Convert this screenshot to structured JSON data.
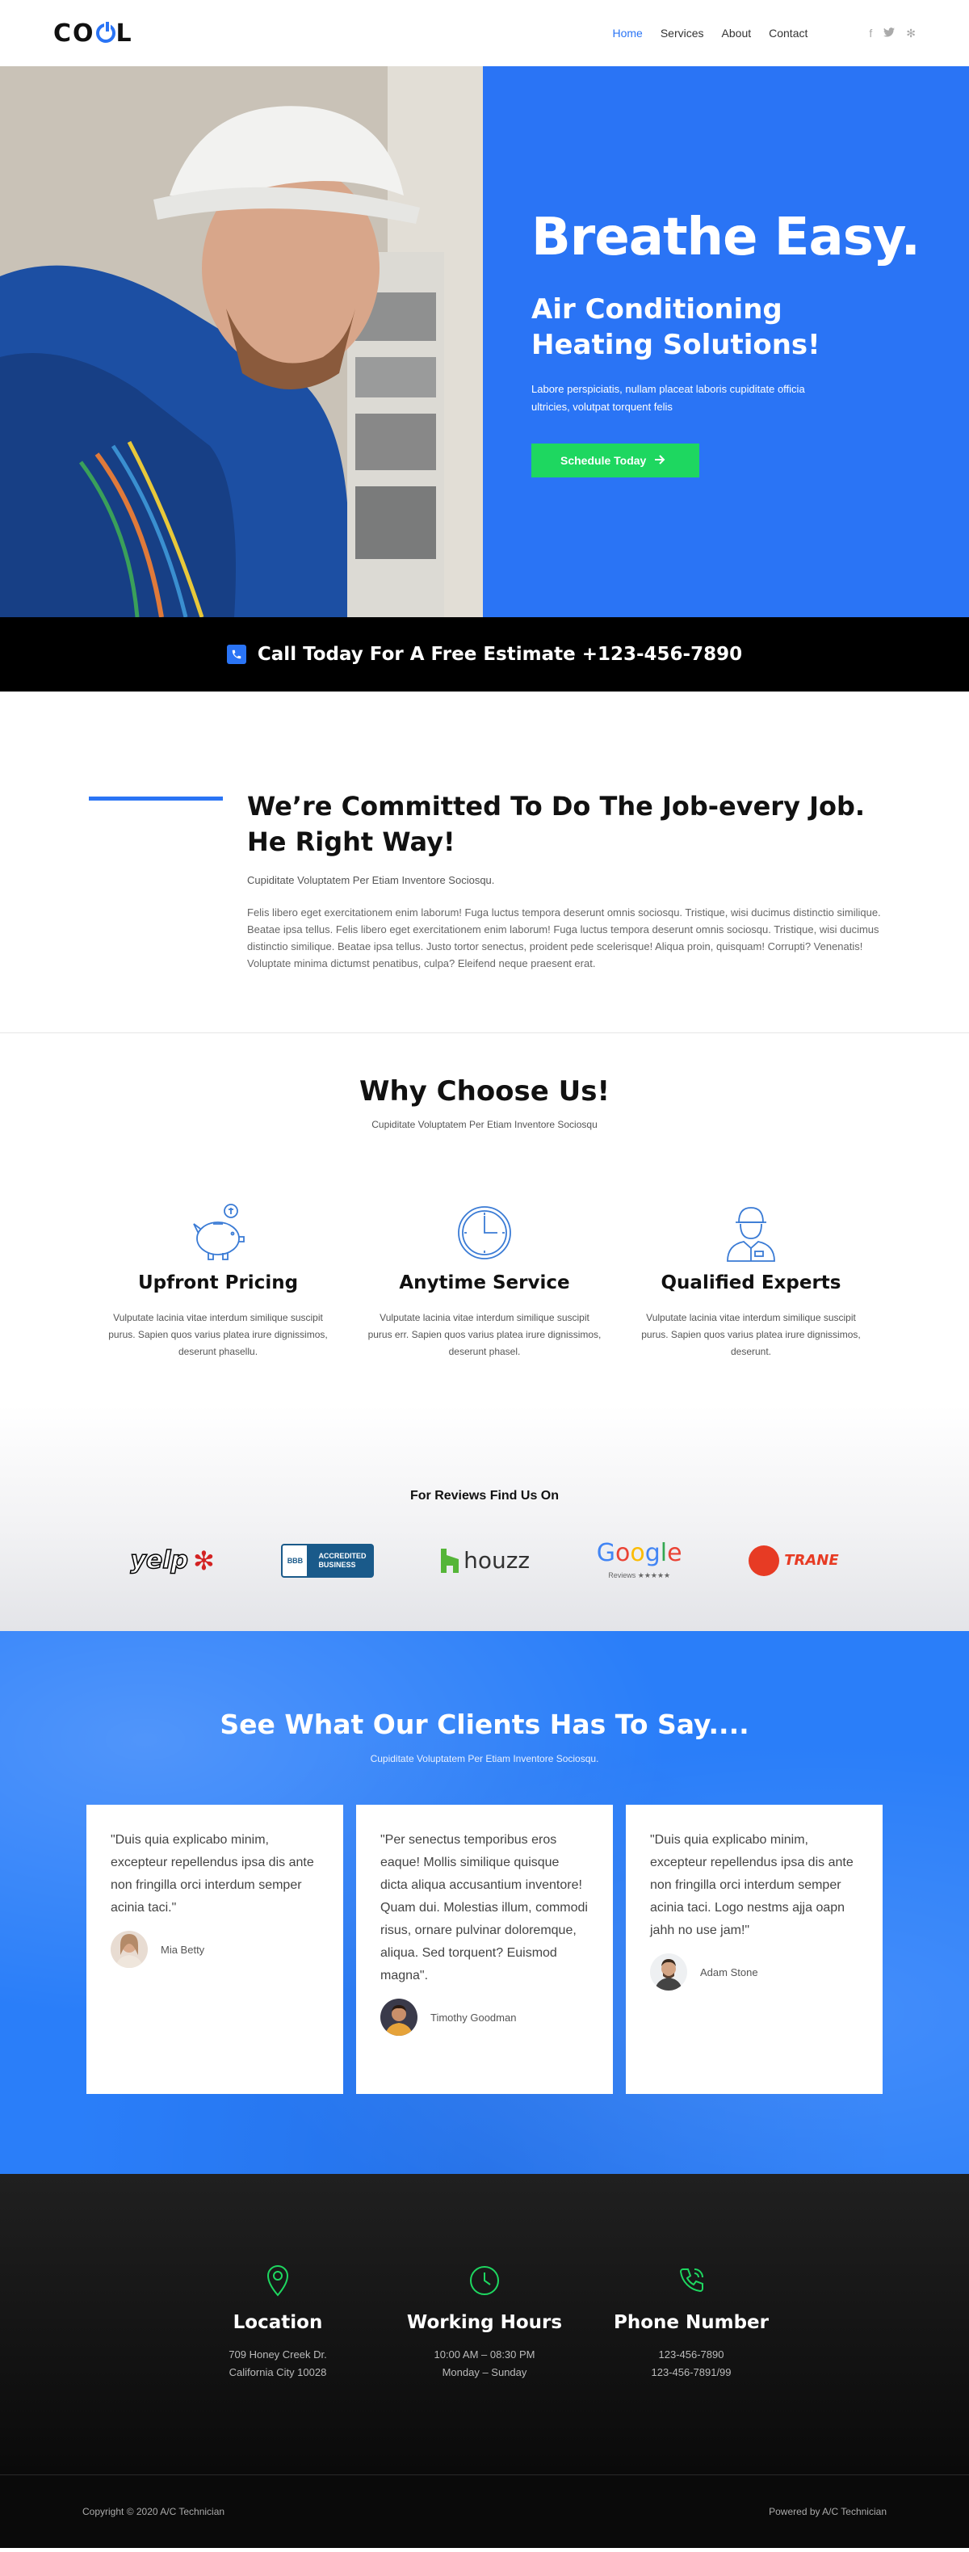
{
  "header": {
    "logo_pre": "C",
    "logo_post": "L",
    "nav": [
      {
        "label": "Home",
        "active": true
      },
      {
        "label": "Services",
        "active": false
      },
      {
        "label": "About",
        "active": false
      },
      {
        "label": "Contact",
        "active": false
      }
    ],
    "social": [
      {
        "icon": "facebook-icon",
        "glyph": "f"
      },
      {
        "icon": "twitter-icon",
        "glyph": "t"
      },
      {
        "icon": "yelp-icon",
        "glyph": "✻"
      }
    ]
  },
  "hero": {
    "title": "Breathe Easy.",
    "subtitle": "Air Conditioning Heating Solutions!",
    "text": "Labore perspiciatis, nullam placeat laboris cupiditate officia ultricies, volutpat torquent felis",
    "button_label": "Schedule Today",
    "button_icon": "arrow-right-icon"
  },
  "callbar": {
    "icon": "phone-icon",
    "text": "Call Today For A Free Estimate +123-456-7890"
  },
  "commit": {
    "title": "We’re Committed To Do The Job-every Job. He Right Way!",
    "lead": "Cupiditate Voluptatem Per Etiam Inventore Sociosqu.",
    "text": "Felis libero eget exercitationem enim laborum! Fuga luctus tempora deserunt omnis sociosqu. Tristique, wisi ducimus distinctio similique. Beatae ipsa tellus. Felis libero eget exercitationem enim laborum! Fuga luctus tempora deserunt omnis sociosqu. Tristique, wisi ducimus distinctio similique. Beatae ipsa tellus. Justo tortor senectus, proident pede scelerisque! Aliqua proin, quisquam! Corrupti? Venenatis! Voluptate minima dictumst penatibus, culpa? Eleifend neque praesent erat."
  },
  "why": {
    "title": "Why Choose Us!",
    "subtitle": "Cupiditate Voluptatem Per Etiam Inventore Sociosqu",
    "features": [
      {
        "icon": "piggy-bank-icon",
        "title": "Upfront Pricing",
        "text": "Vulputate lacinia vitae interdum similique suscipit purus. Sapien quos varius platea irure dignissimos, deserunt phasellu."
      },
      {
        "icon": "clock-icon",
        "title": "Anytime Service",
        "text": "Vulputate lacinia vitae interdum similique suscipit purus err. Sapien quos varius platea irure dignissimos, deserunt phasel."
      },
      {
        "icon": "technician-icon",
        "title": "Qualified Experts",
        "text": "Vulputate lacinia vitae interdum similique suscipit purus. Sapien quos varius platea irure dignissimos, deserunt."
      }
    ]
  },
  "reviews": {
    "title": "For Reviews Find Us On",
    "logos": {
      "yelp": "yelp",
      "bbb_left": "BBB",
      "bbb_right_1": "ACCREDITED",
      "bbb_right_2": "BUSINESS",
      "houzz": "houzz",
      "google": "Google",
      "google_sub": "Reviews ★★★★★",
      "trane": "TRANE"
    }
  },
  "testimonials": {
    "title": "See What Our Clients Has To Say....",
    "subtitle": "Cupiditate Voluptatem Per Etiam Inventore Sociosqu.",
    "items": [
      {
        "quote": "\"Duis quia explicabo minim, excepteur repellendus ipsa dis ante non fringilla orci interdum semper acinia taci.\"",
        "name": "Mia Betty"
      },
      {
        "quote": "\"Per senectus temporibus eros eaque! Mollis similique quisque dicta aliqua accusantium inventore! Quam dui. Molestias illum, commodi risus, ornare pulvinar doloremque, aliqua. Sed torquent? Euismod magna\".",
        "name": "Timothy Goodman"
      },
      {
        "quote": "\"Duis quia explicabo minim, excepteur repellendus ipsa dis ante non fringilla orci interdum semper acinia taci. Logo nestms ajja oapn jahh no use jam!\"",
        "name": "Adam Stone"
      }
    ]
  },
  "info": [
    {
      "icon": "location-pin-icon",
      "title": "Location",
      "lines": [
        "709 Honey Creek Dr.",
        "California City 10028"
      ]
    },
    {
      "icon": "clock-icon",
      "title": "Working Hours",
      "lines": [
        "10:00 AM – 08:30 PM",
        "Monday – Sunday"
      ]
    },
    {
      "icon": "phone-icon",
      "title": "Phone Number",
      "lines": [
        "123-456-7890",
        "123-456-7891/99"
      ]
    }
  ],
  "footer": {
    "copyright": "Copyright © 2020 A/C Technician",
    "powered": "Powered by A/C Technician"
  },
  "colors": {
    "accent": "#2a74f5",
    "button": "#1ed760",
    "info_icons": "#1ed760"
  }
}
